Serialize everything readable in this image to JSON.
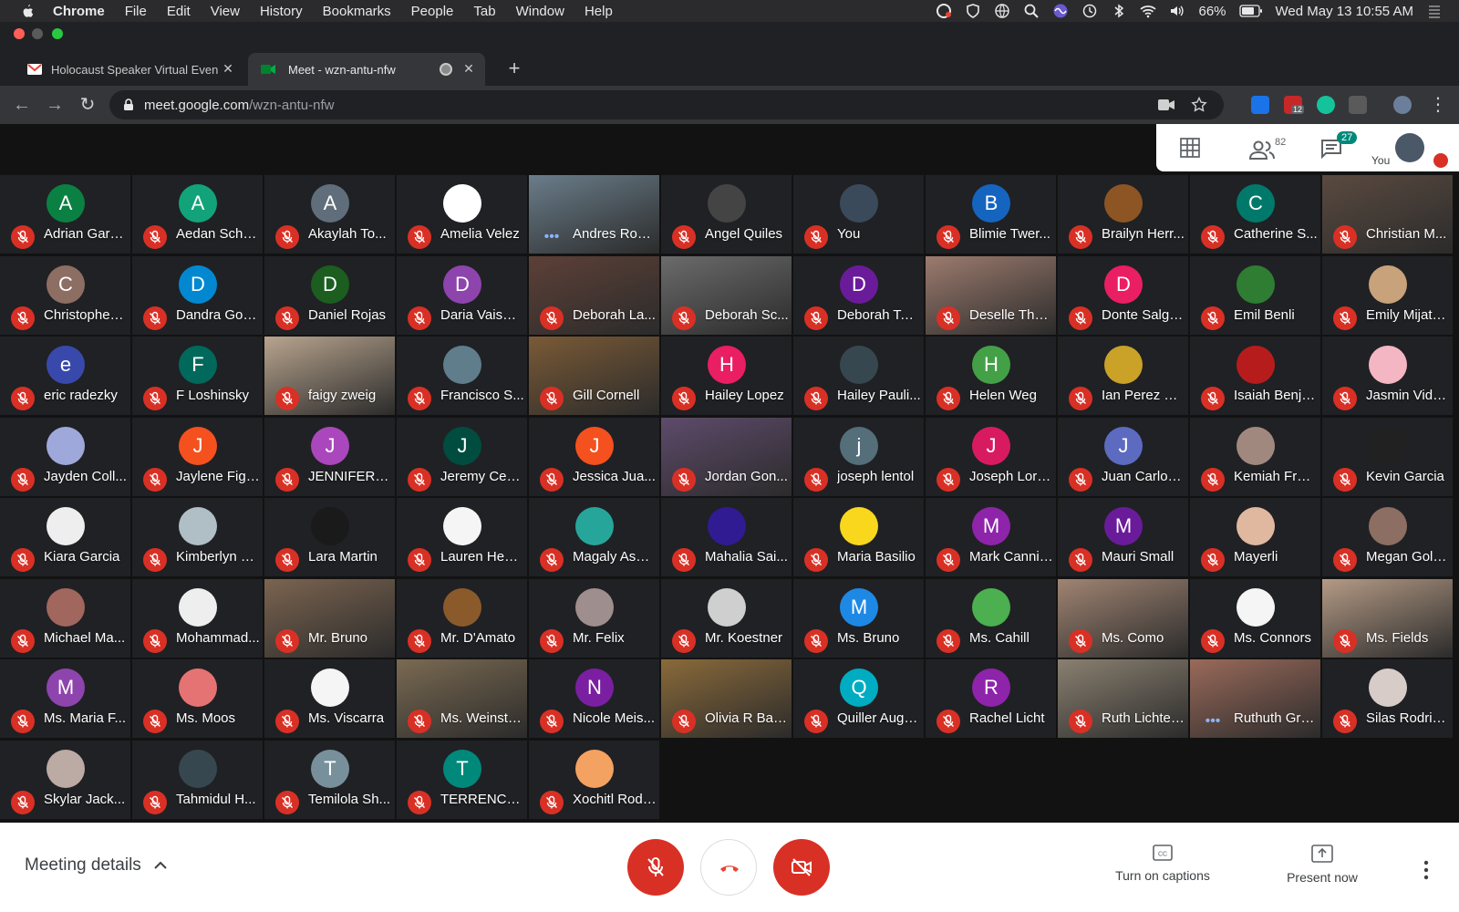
{
  "menubar": {
    "items": [
      "Chrome",
      "File",
      "Edit",
      "View",
      "History",
      "Bookmarks",
      "People",
      "Tab",
      "Window",
      "Help"
    ],
    "battery": "66%",
    "datetime": "Wed May 13  10:55 AM"
  },
  "tabs": [
    {
      "title": "Holocaust Speaker Virtual Even",
      "icon": "gmail-icon",
      "active": false
    },
    {
      "title": "Meet - wzn-antu-nfw",
      "icon": "meet-icon",
      "active": true
    }
  ],
  "address": {
    "host": "meet.google.com",
    "path": "/wzn-antu-nfw"
  },
  "extensions": {
    "adblock_badge": "12"
  },
  "top_panel": {
    "people_count": "82",
    "chat_count": "27",
    "you_label": "You"
  },
  "participants": [
    {
      "name": "Adrian Garci...",
      "initial": "A",
      "color": "#0b8043",
      "type": "letter"
    },
    {
      "name": "Aedan Scho...",
      "initial": "A",
      "color": "#12a37a",
      "type": "letter"
    },
    {
      "name": "Akaylah To...",
      "initial": "A",
      "color": "#5f6e7a",
      "type": "letter"
    },
    {
      "name": "Amelia Velez",
      "initial": "",
      "color": "#ffffff",
      "type": "icon"
    },
    {
      "name": "Andres Rodr...",
      "initial": "",
      "color": "#6a7d8a",
      "type": "video",
      "dots": true
    },
    {
      "name": "Angel Quiles",
      "initial": "",
      "color": "#444444",
      "type": "icon"
    },
    {
      "name": "You",
      "initial": "",
      "color": "#3b4a5a",
      "type": "icon"
    },
    {
      "name": "Blimie Twer...",
      "initial": "B",
      "color": "#1565c0",
      "type": "letter"
    },
    {
      "name": "Brailyn Herr...",
      "initial": "",
      "color": "#8d5524",
      "type": "icon"
    },
    {
      "name": "Catherine S...",
      "initial": "C",
      "color": "#00796b",
      "type": "letter"
    },
    {
      "name": "Christian M...",
      "initial": "",
      "color": "#5a4a40",
      "type": "video"
    },
    {
      "name": "Christopher ...",
      "initial": "C",
      "color": "#8d6e63",
      "type": "letter"
    },
    {
      "name": "Dandra Gord...",
      "initial": "D",
      "color": "#0288d1",
      "type": "letter"
    },
    {
      "name": "Daniel Rojas",
      "initial": "D",
      "color": "#1b5e20",
      "type": "letter"
    },
    {
      "name": "Daria Vaism...",
      "initial": "D",
      "color": "#8e44ad",
      "type": "letter"
    },
    {
      "name": "Deborah La...",
      "initial": "",
      "color": "#5d4037",
      "type": "video"
    },
    {
      "name": "Deborah Sc...",
      "initial": "",
      "color": "#6b6b6b",
      "type": "video"
    },
    {
      "name": "Deborah Ter...",
      "initial": "D",
      "color": "#6a1b9a",
      "type": "letter"
    },
    {
      "name": "Deselle Tho...",
      "initial": "",
      "color": "#9c7b6e",
      "type": "video"
    },
    {
      "name": "Donte Salga...",
      "initial": "D",
      "color": "#e91e63",
      "type": "letter"
    },
    {
      "name": "Emil Benli",
      "initial": "",
      "color": "#2e7d32",
      "type": "icon"
    },
    {
      "name": "Emily Mijato...",
      "initial": "",
      "color": "#c8a27a",
      "type": "icon"
    },
    {
      "name": "eric radezky",
      "initial": "e",
      "color": "#3949ab",
      "type": "letter"
    },
    {
      "name": "F Loshinsky",
      "initial": "F",
      "color": "#00695c",
      "type": "letter"
    },
    {
      "name": "faigy zweig",
      "initial": "",
      "color": "#b8a48e",
      "type": "video"
    },
    {
      "name": "Francisco S...",
      "initial": "",
      "color": "#607d8b",
      "type": "icon"
    },
    {
      "name": "Gill Cornell",
      "initial": "",
      "color": "#7a5a36",
      "type": "video"
    },
    {
      "name": "Hailey Lopez",
      "initial": "H",
      "color": "#e91e63",
      "type": "letter"
    },
    {
      "name": "Hailey Pauli...",
      "initial": "",
      "color": "#37474f",
      "type": "icon"
    },
    {
      "name": "Helen Weg",
      "initial": "H",
      "color": "#43a047",
      "type": "letter"
    },
    {
      "name": "Ian Perez Fl...",
      "initial": "",
      "color": "#c9a227",
      "type": "icon"
    },
    {
      "name": "Isaiah Benja...",
      "initial": "",
      "color": "#b71c1c",
      "type": "icon"
    },
    {
      "name": "Jasmin Vida...",
      "initial": "",
      "color": "#f4b6c2",
      "type": "icon"
    },
    {
      "name": "Jayden Coll...",
      "initial": "",
      "color": "#9fa8da",
      "type": "icon"
    },
    {
      "name": "Jaylene Figu...",
      "initial": "J",
      "color": "#f4511e",
      "type": "letter"
    },
    {
      "name": "JENNIFER G...",
      "initial": "J",
      "color": "#ab47bc",
      "type": "letter"
    },
    {
      "name": "Jeremy Ceb...",
      "initial": "J",
      "color": "#004d40",
      "type": "letter"
    },
    {
      "name": "Jessica Jua...",
      "initial": "J",
      "color": "#f4511e",
      "type": "letter"
    },
    {
      "name": "Jordan Gon...",
      "initial": "",
      "color": "#5e4b6b",
      "type": "video"
    },
    {
      "name": "joseph lentol",
      "initial": "j",
      "color": "#546e7a",
      "type": "letter"
    },
    {
      "name": "Joseph Lore...",
      "initial": "J",
      "color": "#d81b60",
      "type": "letter"
    },
    {
      "name": "Juan Carlos ...",
      "initial": "J",
      "color": "#5c6bc0",
      "type": "letter"
    },
    {
      "name": "Kemiah Fraz...",
      "initial": "",
      "color": "#a1887f",
      "type": "icon"
    },
    {
      "name": "Kevin Garcia",
      "initial": "",
      "color": "#212121",
      "type": "icon"
    },
    {
      "name": "Kiara Garcia",
      "initial": "",
      "color": "#eeeeee",
      "type": "icon"
    },
    {
      "name": "Kimberlyn D...",
      "initial": "",
      "color": "#b0bec5",
      "type": "icon"
    },
    {
      "name": "Lara Martin",
      "initial": "",
      "color": "#1a1a1a",
      "type": "icon"
    },
    {
      "name": "Lauren Henr...",
      "initial": "",
      "color": "#f5f5f5",
      "type": "icon"
    },
    {
      "name": "Magaly Aspi...",
      "initial": "",
      "color": "#26a69a",
      "type": "icon"
    },
    {
      "name": "Mahalia Sai...",
      "initial": "",
      "color": "#311b92",
      "type": "icon"
    },
    {
      "name": "Maria Basilio",
      "initial": "",
      "color": "#f9d71c",
      "type": "icon"
    },
    {
      "name": "Mark Canniz...",
      "initial": "M",
      "color": "#8e24aa",
      "type": "letter"
    },
    {
      "name": "Mauri Small",
      "initial": "M",
      "color": "#6a1b9a",
      "type": "letter"
    },
    {
      "name": "Mayerli",
      "initial": "",
      "color": "#e0b8a0",
      "type": "icon"
    },
    {
      "name": "Megan Gold...",
      "initial": "",
      "color": "#8d6e63",
      "type": "icon"
    },
    {
      "name": "Michael Ma...",
      "initial": "",
      "color": "#a1665e",
      "type": "icon"
    },
    {
      "name": "Mohammad...",
      "initial": "",
      "color": "#eeeeee",
      "type": "icon"
    },
    {
      "name": "Mr. Bruno",
      "initial": "",
      "color": "#7b6450",
      "type": "video"
    },
    {
      "name": "Mr. D'Amato",
      "initial": "",
      "color": "#8b5a2b",
      "type": "icon"
    },
    {
      "name": "Mr. Felix",
      "initial": "",
      "color": "#9e8e8e",
      "type": "icon"
    },
    {
      "name": "Mr. Koestner",
      "initial": "",
      "color": "#cfcfcf",
      "type": "icon"
    },
    {
      "name": "Ms. Bruno",
      "initial": "M",
      "color": "#1e88e5",
      "type": "letter"
    },
    {
      "name": "Ms. Cahill",
      "initial": "",
      "color": "#4caf50",
      "type": "icon"
    },
    {
      "name": "Ms. Como",
      "initial": "",
      "color": "#a08472",
      "type": "video"
    },
    {
      "name": "Ms. Connors",
      "initial": "",
      "color": "#f5f5f5",
      "type": "icon"
    },
    {
      "name": "Ms. Fields",
      "initial": "",
      "color": "#b49a85",
      "type": "video"
    },
    {
      "name": "Ms. Maria F...",
      "initial": "M",
      "color": "#8e44ad",
      "type": "letter"
    },
    {
      "name": "Ms. Moos",
      "initial": "",
      "color": "#e57373",
      "type": "icon"
    },
    {
      "name": "Ms. Viscarra",
      "initial": "",
      "color": "#f5f5f5",
      "type": "icon"
    },
    {
      "name": "Ms. Weinste...",
      "initial": "",
      "color": "#7a6a52",
      "type": "video"
    },
    {
      "name": "Nicole Meis...",
      "initial": "N",
      "color": "#7b1fa2",
      "type": "letter"
    },
    {
      "name": "Olivia R Bau...",
      "initial": "",
      "color": "#8a6a3a",
      "type": "video"
    },
    {
      "name": "Quiller Augu...",
      "initial": "Q",
      "color": "#00acc1",
      "type": "letter"
    },
    {
      "name": "Rachel Licht",
      "initial": "R",
      "color": "#8e24aa",
      "type": "letter"
    },
    {
      "name": "Ruth Lichten...",
      "initial": "",
      "color": "#8a8070",
      "type": "video"
    },
    {
      "name": "Ruthuth Gru...",
      "initial": "",
      "color": "#9a6a5a",
      "type": "video",
      "dots": true
    },
    {
      "name": "Silas Rodrig...",
      "initial": "",
      "color": "#d7ccc8",
      "type": "icon"
    },
    {
      "name": "Skylar Jack...",
      "initial": "",
      "color": "#bcaaa4",
      "type": "icon"
    },
    {
      "name": "Tahmidul H...",
      "initial": "",
      "color": "#37474f",
      "type": "icon"
    },
    {
      "name": "Temilola Sh...",
      "initial": "T",
      "color": "#78909c",
      "type": "letter"
    },
    {
      "name": "TERRENCE ...",
      "initial": "T",
      "color": "#00897b",
      "type": "letter"
    },
    {
      "name": "Xochitl Rodr...",
      "initial": "",
      "color": "#f4a261",
      "type": "icon"
    }
  ],
  "bottom": {
    "meeting_details": "Meeting details",
    "captions": "Turn on captions",
    "present": "Present now"
  },
  "colors": {
    "mute_red": "#d93025",
    "end_call_red": "#ea4335",
    "meet_bg": "#121212"
  }
}
